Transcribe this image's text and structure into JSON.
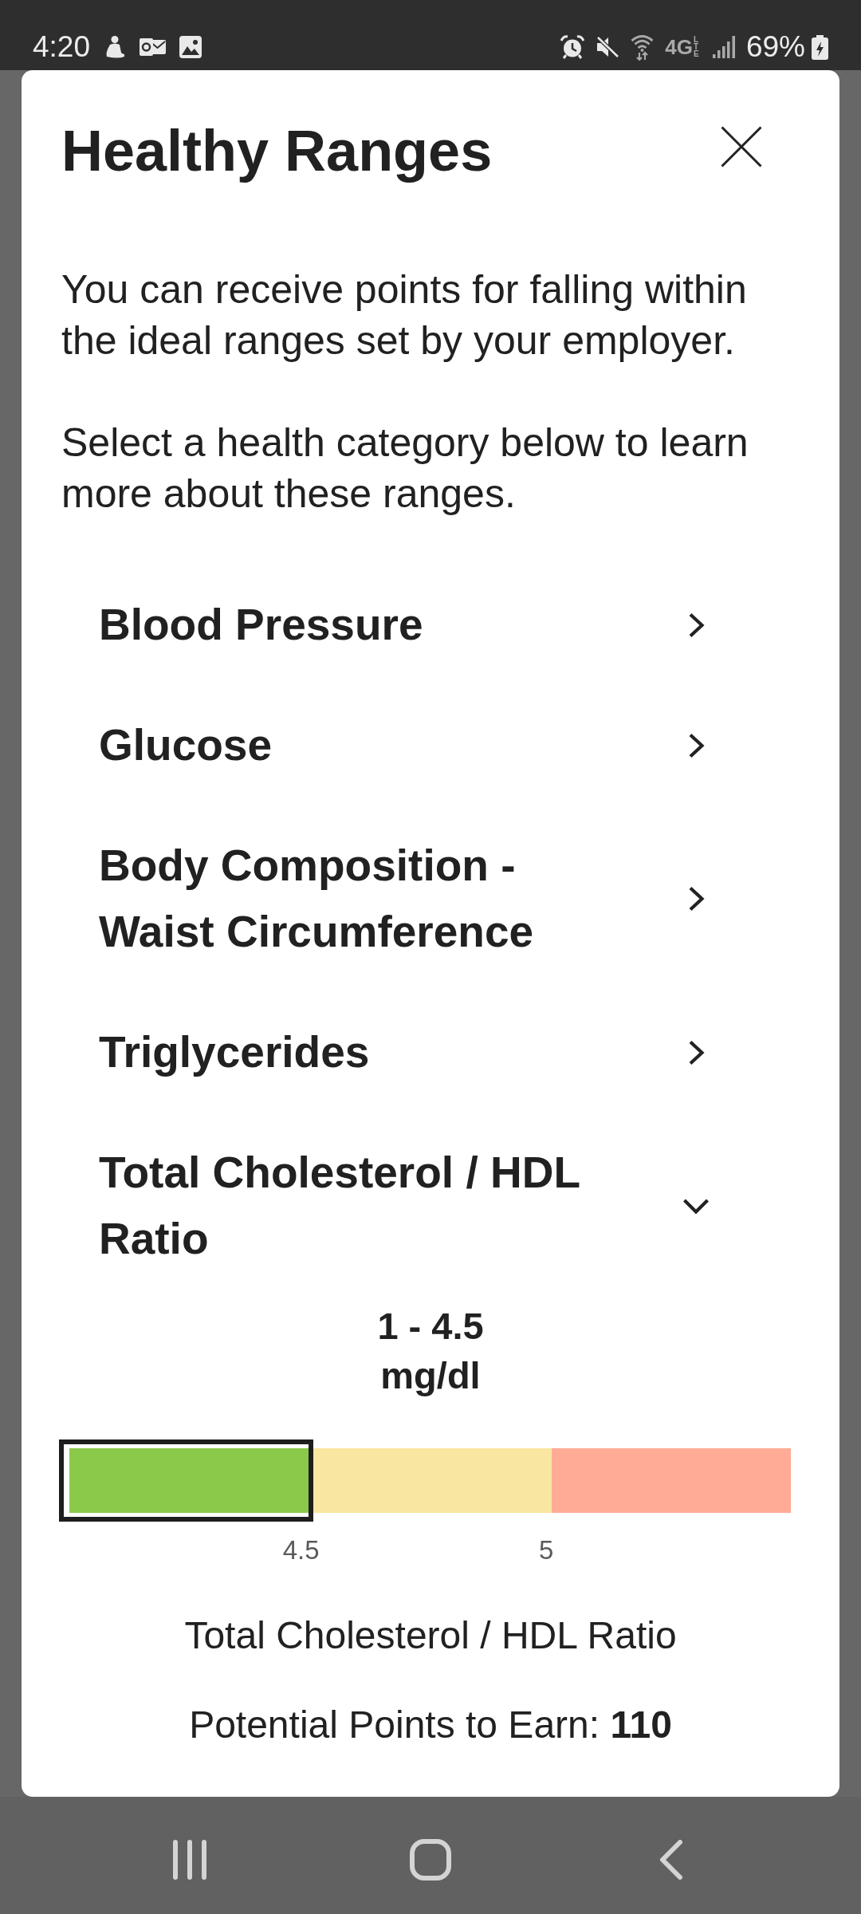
{
  "status_bar": {
    "time": "4:20",
    "network": "4G",
    "network_suffix": "LTE",
    "battery": "69%"
  },
  "dialog": {
    "title": "Healthy Ranges",
    "intro": [
      "You can receive points for falling within the ideal ranges set by your employer.",
      "Select a health category below to learn more about these ranges."
    ],
    "categories": [
      {
        "label": "Blood Pressure",
        "expanded": false
      },
      {
        "label": "Glucose",
        "expanded": false
      },
      {
        "label": "Body Composition - Waist Circumference",
        "expanded": false
      },
      {
        "label": "Triglycerides",
        "expanded": false
      },
      {
        "label": "Total Cholesterol / HDL Ratio",
        "expanded": true,
        "detail": {
          "range": "1 - 4.5 mg/dl",
          "segments": [
            {
              "color": "#8bc94b",
              "selected": true
            },
            {
              "color": "#f9e6a1",
              "selected": false
            },
            {
              "color": "#ffab96",
              "selected": false
            }
          ],
          "ticks": [
            "4.5",
            "5"
          ],
          "measure": "Total Cholesterol / HDL Ratio",
          "points": "Potential Points to Earn: **110**"
        }
      }
    ]
  }
}
